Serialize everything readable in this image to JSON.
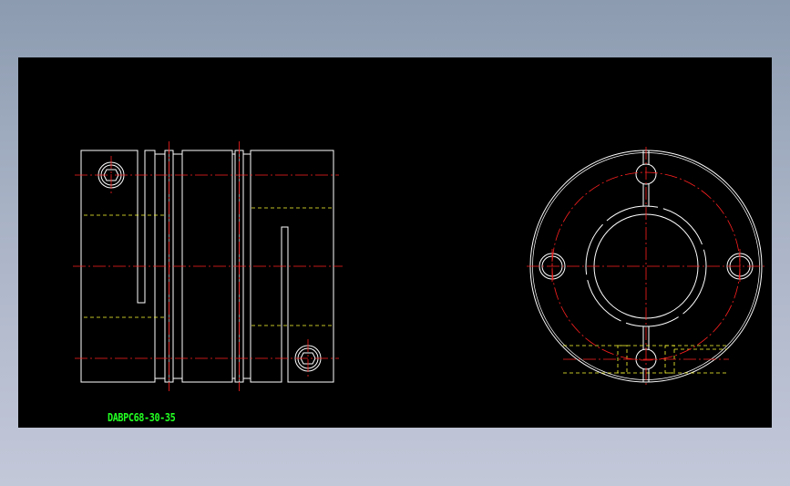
{
  "drawing": {
    "label": "DABPC68-30-35"
  },
  "colors": {
    "background": "#000000",
    "outline": "#ffffff",
    "centerline": "#ff2020",
    "hidden": "#ffff33",
    "label": "#22ff22"
  },
  "icons": {
    "side_view": "coupling-side-view-icon",
    "front_view": "coupling-front-view-icon"
  }
}
